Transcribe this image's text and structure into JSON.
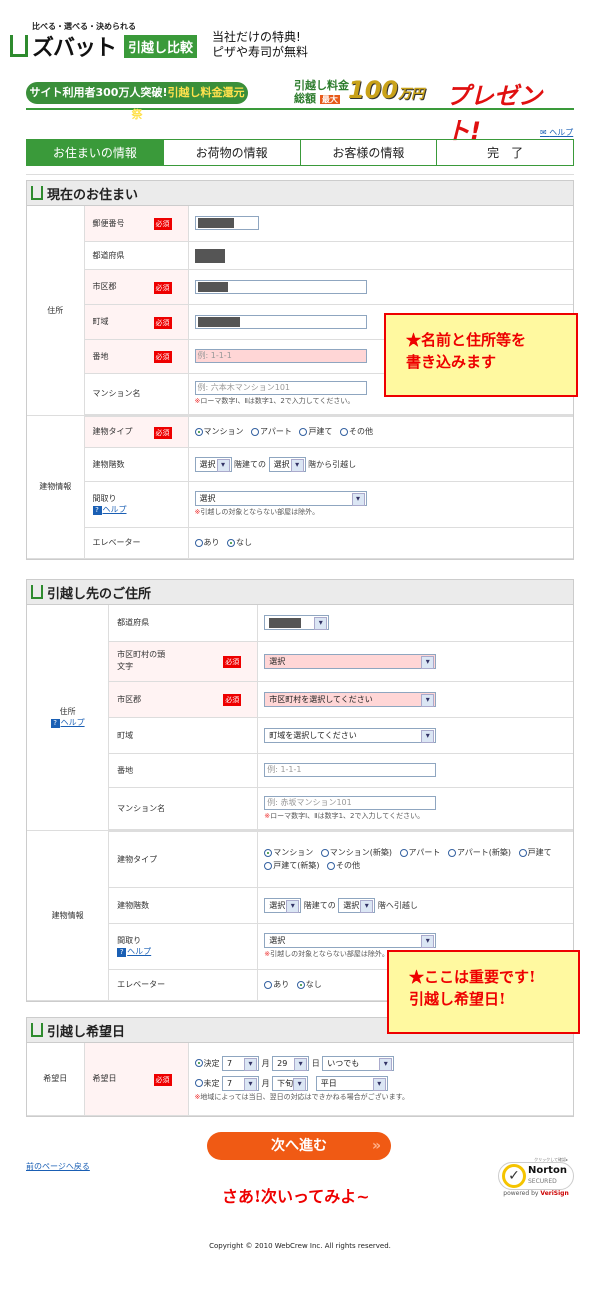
{
  "header": {
    "tagline": "比べる・選べる・決められる",
    "logo": "ズバット",
    "logo_badge": "引越し比較",
    "tokuten_line1": "当社だけの特典!",
    "tokuten_line2": "ピザや寿司が無料"
  },
  "banner": {
    "pill_a": "サイト利用者300万人突破!",
    "pill_b": "引越し料金還元祭",
    "mid_1": "引越し料金",
    "mid_2": "総額",
    "max": "最大",
    "amount": "100",
    "unit": "万円",
    "present": "プレゼント!"
  },
  "help_link": "ヘルプ",
  "steps": [
    {
      "label": "お住まいの情報",
      "active": true
    },
    {
      "label": "お荷物の情報"
    },
    {
      "label": "お客様の情報"
    },
    {
      "label": "完　了"
    }
  ],
  "required": "必須",
  "current": {
    "title": "現在のお住まい",
    "group_address": "住所",
    "group_building": "建物情報",
    "rows": {
      "postal": "郵便番号",
      "pref": "都道府県",
      "city": "市区郡",
      "town": "町域",
      "banchi": "番地",
      "mansion": "マンション名"
    },
    "banchi_placeholder": "例: 1-1-1",
    "mansion_placeholder": "例: 六本木マンション101",
    "roman_note": "ローマ数字Ⅰ、Ⅱは数字1、2で入力してください。",
    "type_label": "建物タイプ",
    "types": [
      "マンション",
      "アパート",
      "戸建て",
      "その他"
    ],
    "type_selected": "マンション",
    "floors_label": "建物階数",
    "select": "選択",
    "floors_mid": "階建ての",
    "floors_end": "階から引越し",
    "madori_label": "間取り",
    "madori_note": "引越しの対象とならない部屋は除外。",
    "elevator_label": "エレベーター",
    "elev_opts": [
      "あり",
      "なし"
    ],
    "elev_selected": "なし"
  },
  "dest": {
    "title": "引越し先のご住所",
    "group_address": "住所",
    "group_building": "建物情報",
    "rows": {
      "pref": "都道府県",
      "initial": "市区町村の頭文字",
      "city": "市区郡",
      "town": "町域",
      "banchi": "番地",
      "mansion": "マンション名"
    },
    "initial_value": "選択",
    "city_value": "市区町村を選択してください",
    "town_value": "町域を選択してください",
    "banchi_placeholder": "例: 1-1-1",
    "mansion_placeholder": "例: 赤坂マンション101",
    "roman_note": "ローマ数字Ⅰ、Ⅱは数字1、2で入力してください。",
    "type_label": "建物タイプ",
    "types": [
      "マンション",
      "マンション(新築)",
      "アパート",
      "アパート(新築)",
      "戸建て",
      "戸建て(新築)",
      "その他"
    ],
    "type_selected": "マンション",
    "floors_label": "建物階数",
    "select": "選択",
    "floors_mid": "階建ての",
    "floors_end": "階へ引越し",
    "madori_label": "間取り",
    "madori_note": "引越しの対象とならない部屋は除外。",
    "elevator_label": "エレベーター",
    "elev_opts": [
      "あり",
      "なし"
    ],
    "elev_selected": "なし"
  },
  "date": {
    "title": "引越し希望日",
    "group": "希望日",
    "label": "希望日",
    "decided": "決定",
    "month": "7",
    "month_unit": "月",
    "day": "29",
    "day_unit": "日",
    "time": "いつでも",
    "undecided": "未定",
    "month2": "7",
    "period": "下旬",
    "weekday": "平日",
    "note": "地域によっては当日、翌日の対応はできかねる場合がございます。",
    "selected": "決定"
  },
  "callouts": {
    "one_l1": "★名前と住所等を",
    "one_l2": "書き込みます",
    "two_l1": "★ここは重要です!",
    "two_l2": "引越し希望日!"
  },
  "footer": {
    "next": "次へ進む",
    "back": "前のページへ戻る",
    "saa": "さあ!次いってみよ~",
    "norton_top": "クリックして確認▸",
    "norton": "Norton",
    "secured": "SECURED",
    "powered": "powered by",
    "verisign": "VeriSign",
    "copyright": "Copyright © 2010 WebCrew Inc. All rights reserved."
  }
}
